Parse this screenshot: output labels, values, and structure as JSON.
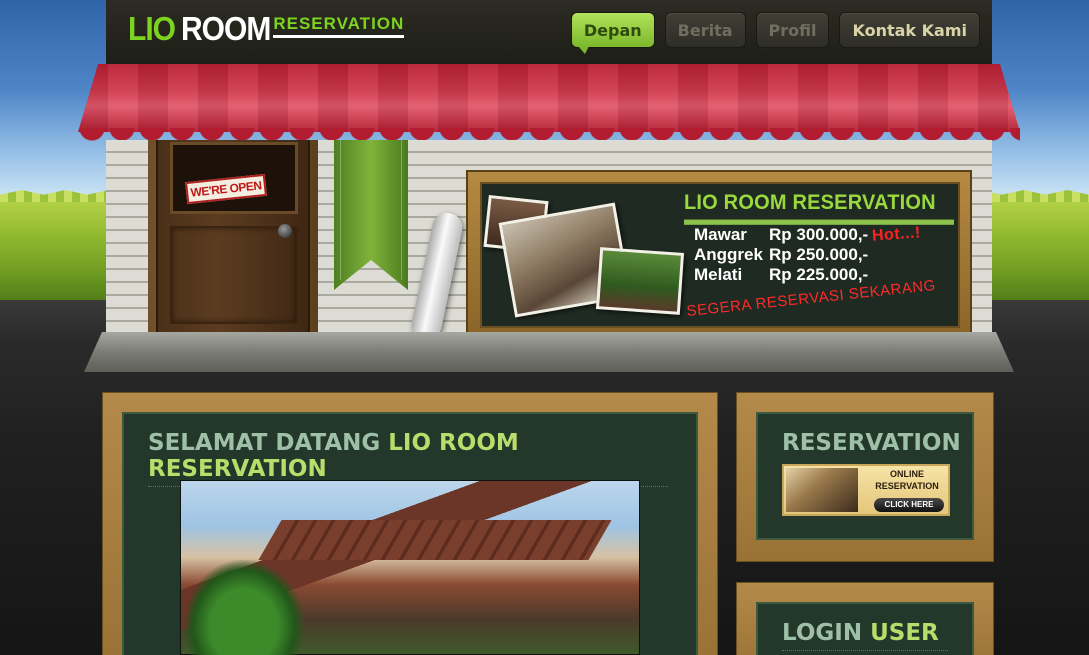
{
  "header": {
    "logo": {
      "part1": "LIO",
      "part2": "ROOM",
      "part3": "RESERVATION"
    },
    "nav": [
      {
        "label": "Depan",
        "active": true
      },
      {
        "label": "Berita",
        "active": false
      },
      {
        "label": "Profil",
        "active": false
      },
      {
        "label": "Kontak Kami",
        "active": false
      }
    ]
  },
  "shopfront": {
    "door_sign": "WE'RE OPEN",
    "board": {
      "title": "LIO ROOM RESERVATION",
      "prices": [
        {
          "name": "Mawar",
          "price": "Rp 300.000,-",
          "badge": "Hot...!"
        },
        {
          "name": "Anggrek",
          "price": "Rp 250.000,-"
        },
        {
          "name": "Melati",
          "price": "Rp 225.000,-"
        }
      ],
      "cta": "SEGERA RESERVASI SEKARANG"
    }
  },
  "main": {
    "title_part1": "SELAMAT DATANG",
    "title_part2": "LIO ROOM RESERVATION"
  },
  "sidebar": {
    "reservation": {
      "title": "RESERVATION",
      "banner_line1": "ONLINE",
      "banner_line2": "RESERVATION",
      "banner_button": "CLICK HERE"
    },
    "login": {
      "title_part1": "LOGIN",
      "title_part2": "USER"
    }
  },
  "colors": {
    "accent_green": "#7ed321",
    "awning_red": "#c8283d",
    "panel_frame": "#b48a4a",
    "panel_inner": "#24372b",
    "title_green": "#9dc0a6",
    "title_lime": "#b8dd6a"
  }
}
